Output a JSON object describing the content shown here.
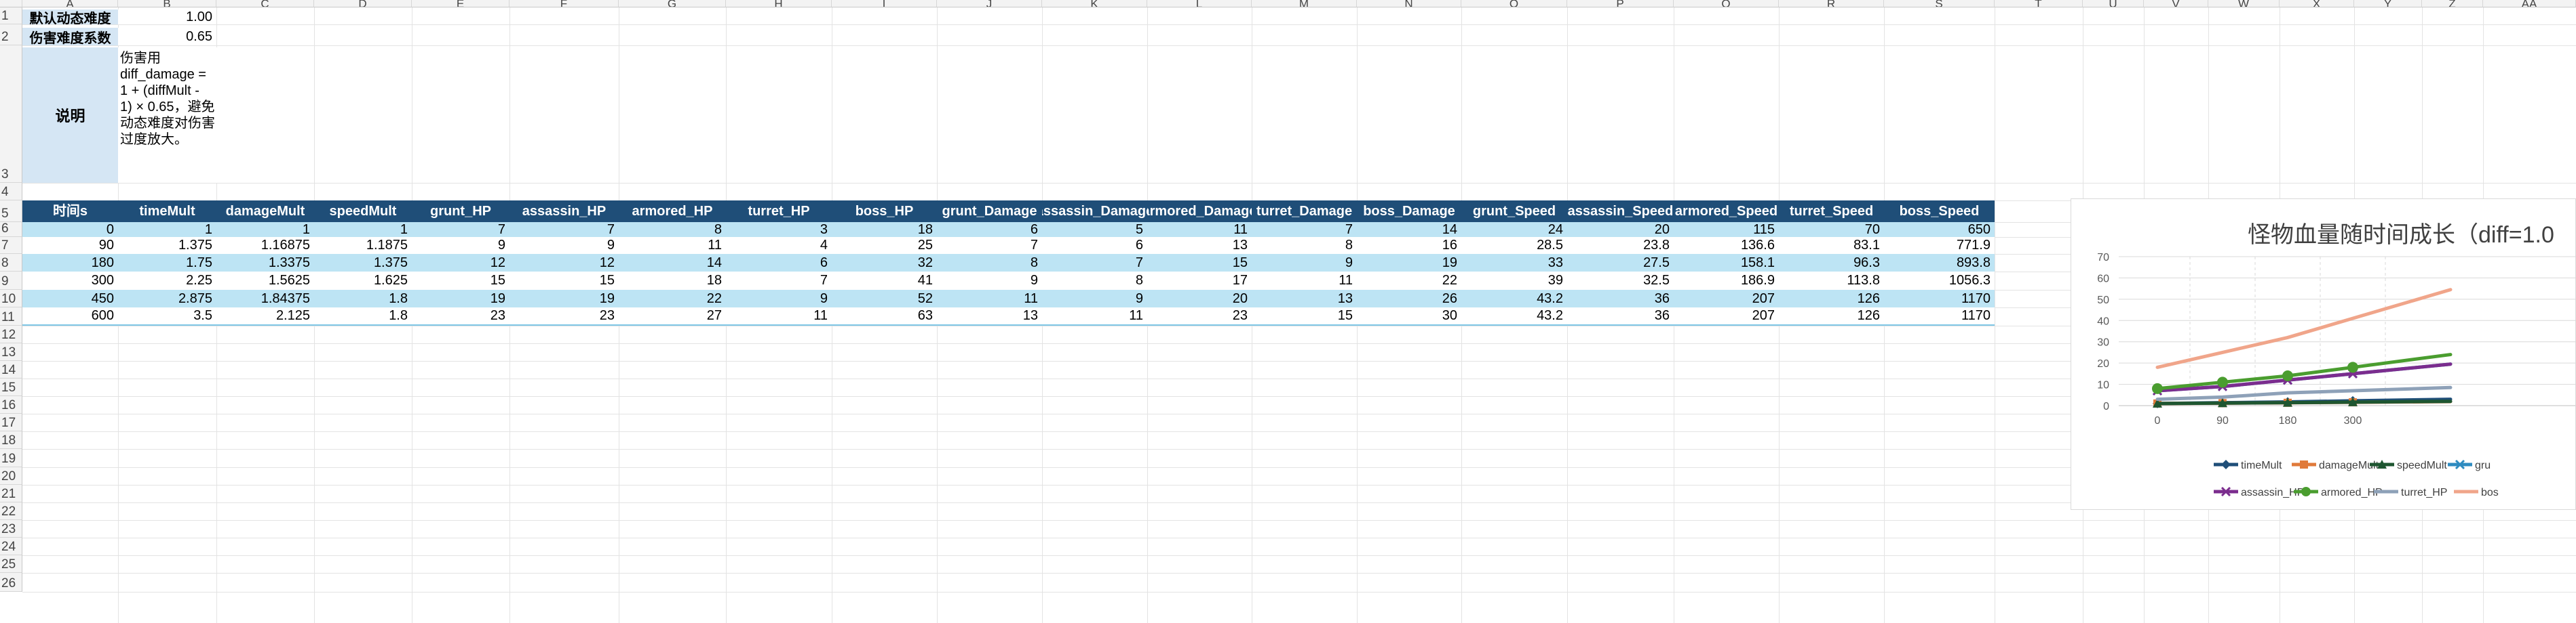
{
  "columns": [
    "A",
    "B",
    "C",
    "D",
    "E",
    "F",
    "G",
    "H",
    "I",
    "J",
    "K",
    "L",
    "M",
    "N",
    "O",
    "P",
    "Q",
    "R",
    "S",
    "T",
    "U",
    "V",
    "W",
    "X",
    "Y",
    "Z",
    "AA"
  ],
  "row_numbers": [
    "1",
    "2",
    "3",
    "4",
    "5",
    "6",
    "7",
    "8",
    "9",
    "10",
    "11",
    "12",
    "13",
    "14",
    "15",
    "16",
    "17",
    "18",
    "19",
    "20",
    "21",
    "22",
    "23",
    "24",
    "25",
    "26"
  ],
  "params": {
    "row1_label": "默认动态难度",
    "row1_value": "1.00",
    "row2_label": "伤害难度系数",
    "row2_value": "0.65",
    "row3_label": "说明",
    "row3_desc": "伤害用 diff_damage = 1 + (diffMult - 1) × 0.65，避免动态难度对伤害过度放大。"
  },
  "table": {
    "headers": [
      "时间s",
      "timeMult",
      "damageMult",
      "speedMult",
      "grunt_HP",
      "assassin_HP",
      "armored_HP",
      "turret_HP",
      "boss_HP",
      "grunt_Damage",
      "assassin_Damage",
      "armored_Damage",
      "turret_Damage",
      "boss_Damage",
      "grunt_Speed",
      "assassin_Speed",
      "armored_Speed",
      "turret_Speed",
      "boss_Speed"
    ],
    "rows": [
      [
        "0",
        "1",
        "1",
        "1",
        "7",
        "7",
        "8",
        "3",
        "18",
        "6",
        "5",
        "11",
        "7",
        "14",
        "24",
        "20",
        "115",
        "70",
        "650"
      ],
      [
        "90",
        "1.375",
        "1.16875",
        "1.1875",
        "9",
        "9",
        "11",
        "4",
        "25",
        "7",
        "6",
        "13",
        "8",
        "16",
        "28.5",
        "23.8",
        "136.6",
        "83.1",
        "771.9"
      ],
      [
        "180",
        "1.75",
        "1.3375",
        "1.375",
        "12",
        "12",
        "14",
        "6",
        "32",
        "8",
        "7",
        "15",
        "9",
        "19",
        "33",
        "27.5",
        "158.1",
        "96.3",
        "893.8"
      ],
      [
        "300",
        "2.25",
        "1.5625",
        "1.625",
        "15",
        "15",
        "18",
        "7",
        "41",
        "9",
        "8",
        "17",
        "11",
        "22",
        "39",
        "32.5",
        "186.9",
        "113.8",
        "1056.3"
      ],
      [
        "450",
        "2.875",
        "1.84375",
        "1.8",
        "19",
        "19",
        "22",
        "9",
        "52",
        "11",
        "9",
        "20",
        "13",
        "26",
        "43.2",
        "36",
        "207",
        "126",
        "1170"
      ],
      [
        "600",
        "3.5",
        "2.125",
        "1.8",
        "23",
        "23",
        "27",
        "11",
        "63",
        "13",
        "11",
        "23",
        "15",
        "30",
        "43.2",
        "36",
        "207",
        "126",
        "1170"
      ]
    ]
  },
  "chart_data": {
    "type": "line",
    "title": "怪物血量随时间成长（diff=1.0",
    "categories": [
      "0",
      "90",
      "180",
      "300"
    ],
    "y_ticks": [
      "0",
      "10",
      "20",
      "30",
      "40",
      "50",
      "60",
      "70"
    ],
    "ylim": [
      0,
      70
    ],
    "grid": true,
    "legend_position": "bottom",
    "series": [
      {
        "name": "timeMult",
        "values": [
          1,
          1.375,
          1.75,
          2.25
        ],
        "color": "#1f4e78",
        "marker": "diamond"
      },
      {
        "name": "damageMult",
        "values": [
          1,
          1.16875,
          1.3375,
          1.5625
        ],
        "color": "#e07a3a",
        "marker": "square"
      },
      {
        "name": "speedMult",
        "values": [
          1,
          1.1875,
          1.375,
          1.625
        ],
        "color": "#1e5631",
        "marker": "triangle"
      },
      {
        "name": "gru",
        "values": [
          7,
          9,
          12,
          15
        ],
        "color": "#2e8bc0",
        "marker": "x"
      },
      {
        "name": "assassin_HP",
        "values": [
          7,
          9,
          12,
          15
        ],
        "color": "#7b2d8e",
        "marker": "x"
      },
      {
        "name": "armored_HP",
        "values": [
          8,
          11,
          14,
          18
        ],
        "color": "#4a9d2f",
        "marker": "circle"
      },
      {
        "name": "turret_HP",
        "values": [
          3,
          4,
          6,
          7
        ],
        "color": "#8ea1b8",
        "marker": "none"
      },
      {
        "name": "bos",
        "values": [
          18,
          25,
          32,
          41
        ],
        "color": "#f0a58a",
        "marker": "none"
      }
    ]
  }
}
